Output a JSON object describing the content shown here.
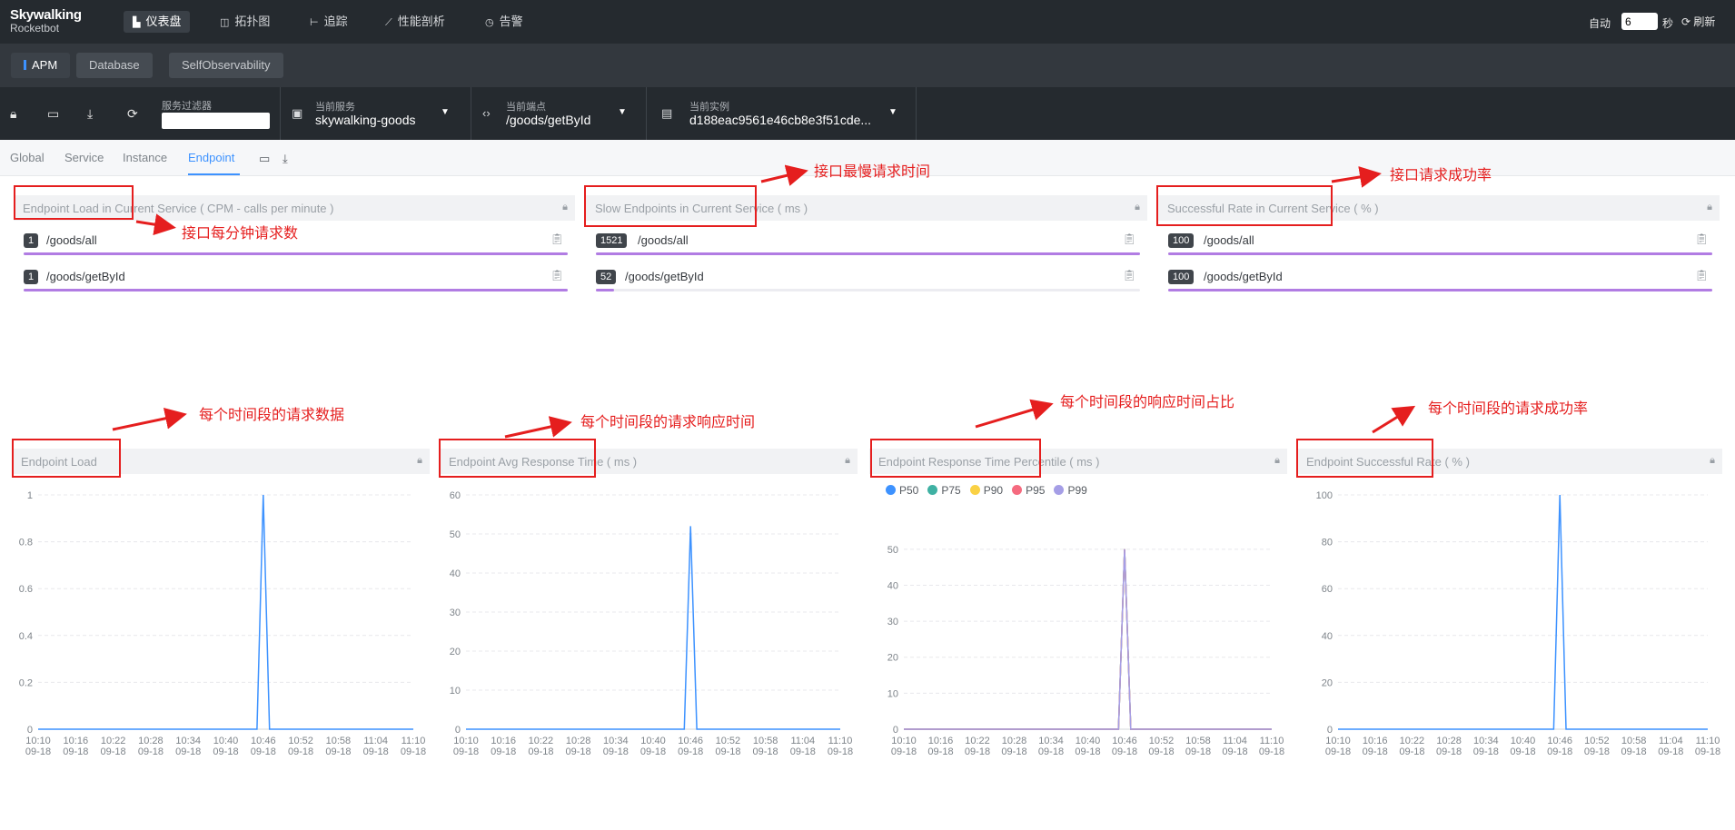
{
  "header": {
    "logo_title": "Skywalking",
    "logo_subtitle": "Rocketbot",
    "nav": [
      {
        "label": "仪表盘",
        "icon": "dashboard-icon",
        "active": true
      },
      {
        "label": "拓扑图",
        "icon": "topology-icon",
        "active": false
      },
      {
        "label": "追踪",
        "icon": "trace-icon",
        "active": false
      },
      {
        "label": "性能剖析",
        "icon": "profile-icon",
        "active": false
      },
      {
        "label": "告警",
        "icon": "alarm-icon",
        "active": false
      }
    ],
    "auto_label": "自动",
    "auto_interval": "6",
    "seconds_label": "秒",
    "refresh_label": "刷新"
  },
  "groups": [
    {
      "label": "APM",
      "active": true
    },
    {
      "label": "Database",
      "active": false
    },
    {
      "label": "SelfObservability",
      "active": false
    }
  ],
  "selectors": {
    "filter_label": "服务过滤器",
    "filter_value": "",
    "service": {
      "title": "当前服务",
      "value": "skywalking-goods"
    },
    "endpoint": {
      "title": "当前端点",
      "value": "/goods/getById"
    },
    "instance": {
      "title": "当前实例",
      "value": "d188eac9561e46cb8e3f51cde..."
    }
  },
  "tabs": [
    {
      "label": "Global",
      "active": false
    },
    {
      "label": "Service",
      "active": false
    },
    {
      "label": "Instance",
      "active": false
    },
    {
      "label": "Endpoint",
      "active": true
    }
  ],
  "top_panels": [
    {
      "title": "Endpoint Load in Current Service ( CPM - calls per minute )",
      "rows": [
        {
          "value": "1",
          "endpoint": "/goods/all",
          "fraction": 1.0
        },
        {
          "value": "1",
          "endpoint": "/goods/getById",
          "fraction": 1.0
        }
      ]
    },
    {
      "title": "Slow Endpoints in Current Service ( ms )",
      "rows": [
        {
          "value": "1521",
          "endpoint": "/goods/all",
          "fraction": 1.0
        },
        {
          "value": "52",
          "endpoint": "/goods/getById",
          "fraction": 0.034
        }
      ]
    },
    {
      "title": "Successful Rate in Current Service ( % )",
      "rows": [
        {
          "value": "100",
          "endpoint": "/goods/all",
          "fraction": 1.0
        },
        {
          "value": "100",
          "endpoint": "/goods/getById",
          "fraction": 1.0
        }
      ]
    }
  ],
  "annotations": {
    "load_current": "接口每分钟请求数",
    "slow_endpoints": "接口最慢请求时间",
    "success_current": "接口请求成功率",
    "load_time": "每个时间段的请求数据",
    "avg_response": "每个时间段的请求响应时间",
    "percentile": "每个时间段的响应时间占比",
    "success_time": "每个时间段的请求成功率"
  },
  "colors": {
    "line_blue": "#3d92ff",
    "bar_purple": "#b17ce3",
    "p50": "#3d92ff",
    "p75": "#3fb1a3",
    "p90": "#fad144",
    "p95": "#f56a7f",
    "p99": "#a59ee6",
    "annotation_red": "#e51e1e"
  },
  "chart_data": [
    {
      "type": "line",
      "title": "Endpoint Load",
      "x": [
        "10:10\n09-18",
        "10:16\n09-18",
        "10:22\n09-18",
        "10:28\n09-18",
        "10:34\n09-18",
        "10:40\n09-18",
        "10:46\n09-18",
        "10:52\n09-18",
        "10:58\n09-18",
        "11:04\n09-18",
        "11:10\n09-18"
      ],
      "yticks": [
        "0",
        "0.2",
        "0.4",
        "0.6",
        "0.8",
        "1"
      ],
      "ylim": [
        0,
        1
      ],
      "series": [
        {
          "name": "",
          "peak_index": 36,
          "peak_value": 1,
          "points": 61
        }
      ]
    },
    {
      "type": "line",
      "title": "Endpoint Avg Response Time ( ms )",
      "x": [
        "10:10\n09-18",
        "10:16\n09-18",
        "10:22\n09-18",
        "10:28\n09-18",
        "10:34\n09-18",
        "10:40\n09-18",
        "10:46\n09-18",
        "10:52\n09-18",
        "10:58\n09-18",
        "11:04\n09-18",
        "11:10\n09-18"
      ],
      "yticks": [
        "0",
        "10",
        "20",
        "30",
        "40",
        "50",
        "60"
      ],
      "ylim": [
        0,
        60
      ],
      "series": [
        {
          "name": "",
          "peak_index": 36,
          "peak_value": 52,
          "points": 61
        }
      ]
    },
    {
      "type": "line",
      "title": "Endpoint Response Time Percentile ( ms )",
      "x": [
        "10:10\n09-18",
        "10:16\n09-18",
        "10:22\n09-18",
        "10:28\n09-18",
        "10:34\n09-18",
        "10:40\n09-18",
        "10:46\n09-18",
        "10:52\n09-18",
        "10:58\n09-18",
        "11:04\n09-18",
        "11:10\n09-18"
      ],
      "yticks": [
        "0",
        "10",
        "20",
        "30",
        "40",
        "50"
      ],
      "ylim": [
        0,
        55
      ],
      "series": [
        {
          "name": "P50",
          "peak_index": 36,
          "peak_value": 50,
          "points": 61
        },
        {
          "name": "P75",
          "peak_index": 36,
          "peak_value": 50,
          "points": 61
        },
        {
          "name": "P90",
          "peak_index": 36,
          "peak_value": 50,
          "points": 61
        },
        {
          "name": "P95",
          "peak_index": 36,
          "peak_value": 50,
          "points": 61
        },
        {
          "name": "P99",
          "peak_index": 36,
          "peak_value": 50,
          "points": 61
        }
      ]
    },
    {
      "type": "line",
      "title": "Endpoint Successful Rate ( % )",
      "x": [
        "10:10\n09-18",
        "10:16\n09-18",
        "10:22\n09-18",
        "10:28\n09-18",
        "10:34\n09-18",
        "10:40\n09-18",
        "10:46\n09-18",
        "10:52\n09-18",
        "10:58\n09-18",
        "11:04\n09-18",
        "11:10\n09-18"
      ],
      "yticks": [
        "0",
        "20",
        "40",
        "60",
        "80",
        "100"
      ],
      "ylim": [
        0,
        100
      ],
      "series": [
        {
          "name": "",
          "peak_index": 36,
          "peak_value": 100,
          "points": 61
        }
      ]
    }
  ]
}
